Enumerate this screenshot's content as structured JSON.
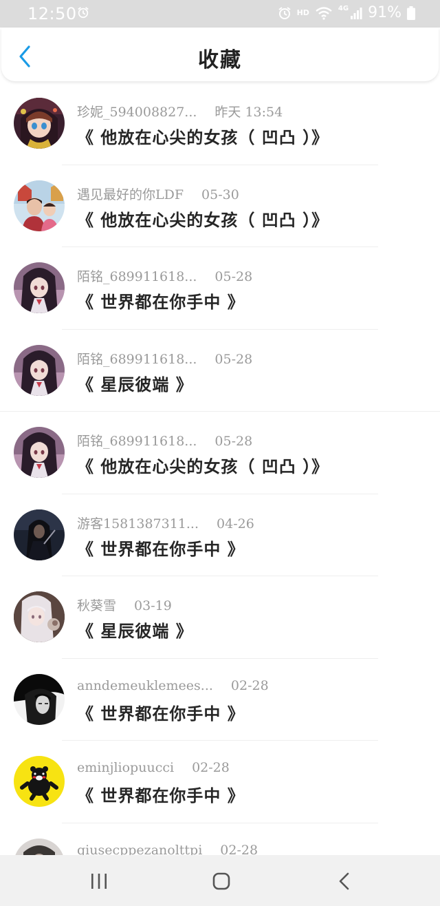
{
  "status_bar": {
    "time": "12:50",
    "hd": "HD",
    "network": "4G",
    "battery": "91%",
    "left_icons": [
      "alarm-icon"
    ],
    "right_icons": [
      "alarm-icon",
      "hd-icon",
      "wifi-icon",
      "signal-icon",
      "battery-icon"
    ]
  },
  "header": {
    "title": "收藏",
    "back_icon": "chevron-left-icon",
    "accent_color": "#1a9be6"
  },
  "favorites": [
    {
      "username": "珍妮_594008827...",
      "time": "昨天 13:54",
      "book": "《 他放在心尖的女孩（ 凹凸 ）》",
      "avatar": "anime-girl-colorful"
    },
    {
      "username": "遇见最好的你LDF",
      "time": "05-30",
      "book": "《 他放在心尖的女孩（ 凹凸 ）》",
      "avatar": "photo-two-people"
    },
    {
      "username": "陌铭_689911618...",
      "time": "05-28",
      "book": "《 世界都在你手中 》",
      "avatar": "anime-girl-dark-hair"
    },
    {
      "username": "陌铭_689911618...",
      "time": "05-28",
      "book": "《 星辰彼端 》",
      "avatar": "anime-girl-dark-hair"
    },
    {
      "username": "陌铭_689911618...",
      "time": "05-28",
      "book": "《 他放在心尖的女孩（ 凹凸 ）》",
      "avatar": "anime-girl-dark-hair"
    },
    {
      "username": "游客1581387311...",
      "time": "04-26",
      "book": "《 世界都在你手中 》",
      "avatar": "dark-hooded-figure"
    },
    {
      "username": "秋葵雪",
      "time": "03-19",
      "book": "《 星辰彼端 》",
      "avatar": "white-hair-girl"
    },
    {
      "username": "anndemeuklemees...",
      "time": "02-28",
      "book": "《 世界都在你手中 》",
      "avatar": "black-white-portrait"
    },
    {
      "username": "eminjliopuucci",
      "time": "02-28",
      "book": "《 世界都在你手中 》",
      "avatar": "yellow-bear"
    },
    {
      "username": "giusecppezanolttpi",
      "time": "02-28",
      "book": "",
      "avatar": "partial-photo"
    }
  ],
  "nav_bar": {
    "buttons": [
      "recent-apps-icon",
      "home-icon",
      "back-icon"
    ]
  }
}
